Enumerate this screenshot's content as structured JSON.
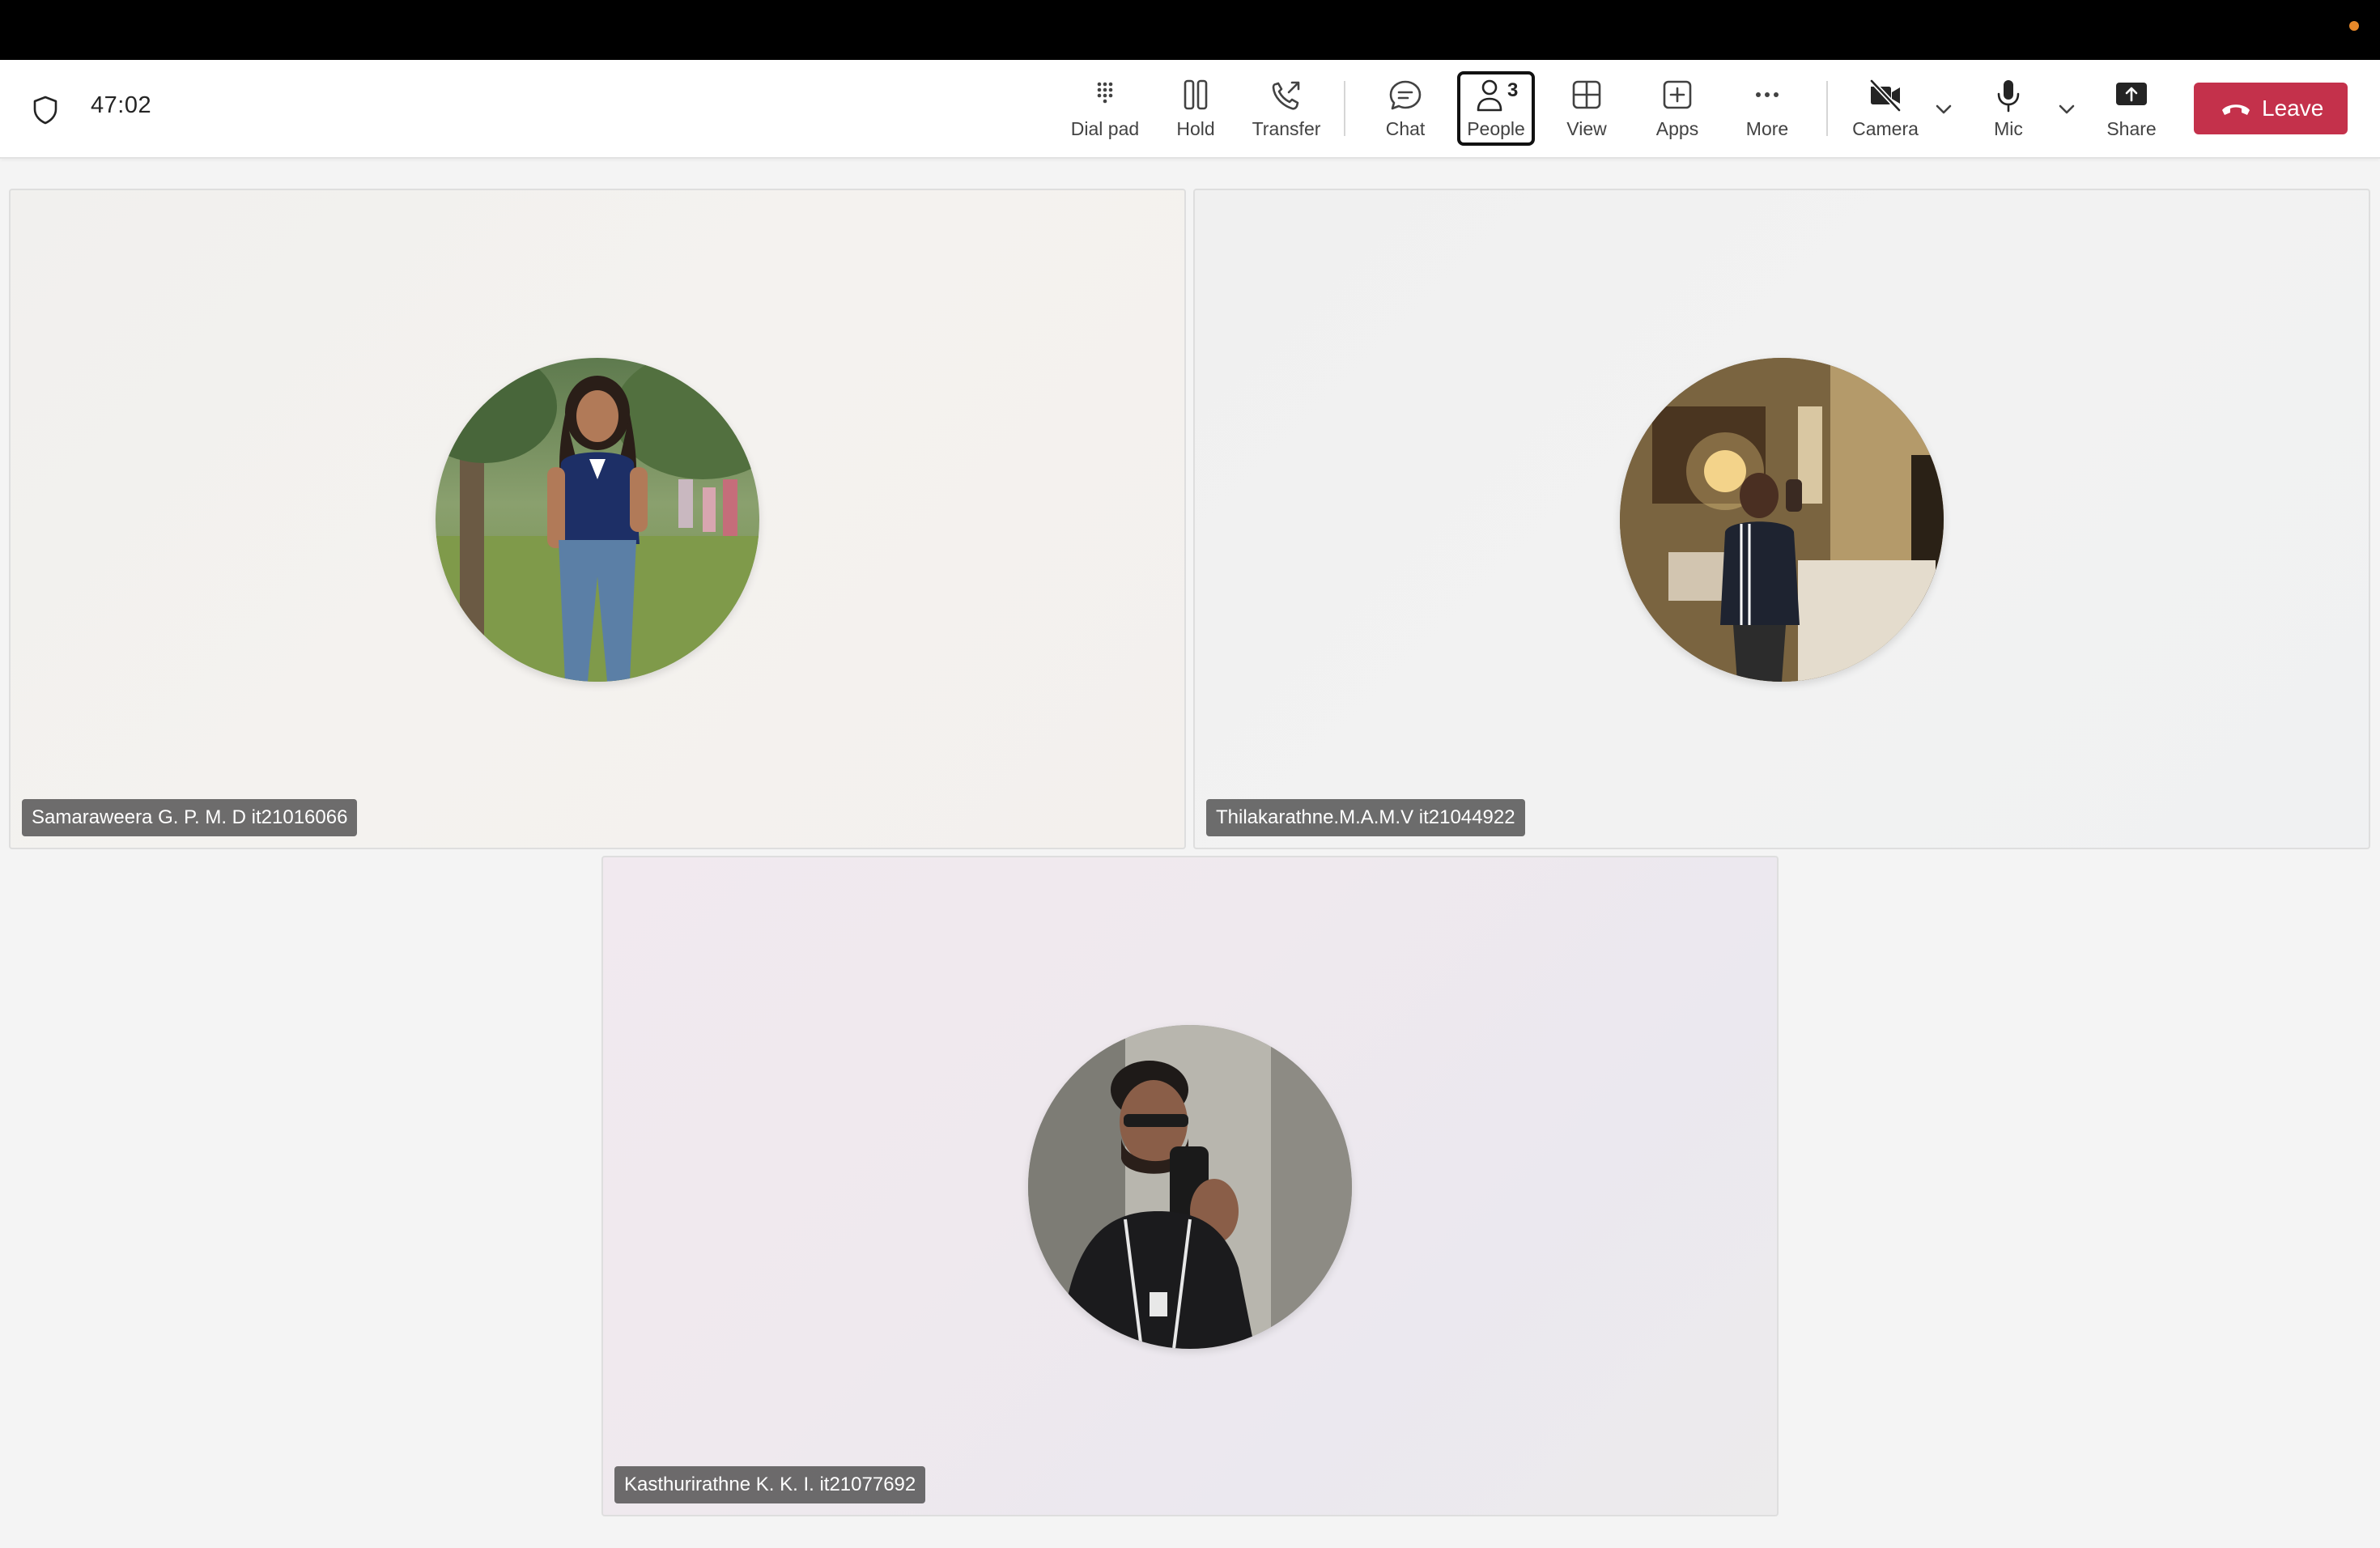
{
  "call": {
    "timer": "47:02"
  },
  "toolbar": {
    "dial_pad": "Dial pad",
    "hold": "Hold",
    "transfer": "Transfer",
    "chat": "Chat",
    "people": "People",
    "people_count": "3",
    "view": "View",
    "apps": "Apps",
    "more": "More",
    "camera": "Camera",
    "mic": "Mic",
    "share": "Share",
    "leave": "Leave",
    "active_tab": "People"
  },
  "participants": [
    {
      "name": "Samaraweera G. P. M. D it21016066",
      "avatar": "photo-woman-outdoors"
    },
    {
      "name": "Thilakarathne.M.A.M.V it21044922",
      "avatar": "photo-man-room-selfie"
    },
    {
      "name": "Kasthurirathne K. K. I. it21077692",
      "avatar": "photo-man-mirror-selfie"
    }
  ],
  "colors": {
    "leave_button": "#c4314b",
    "status_dot": "#e8892a",
    "top_bar": "#000000"
  },
  "icons": [
    "shield-icon",
    "dial-pad-icon",
    "pause-icon",
    "transfer-icon",
    "chat-icon",
    "people-icon",
    "grid-view-icon",
    "add-apps-icon",
    "more-icon",
    "camera-off-icon",
    "mic-icon",
    "share-icon",
    "phone-hangup-icon",
    "chevron-down-icon"
  ]
}
